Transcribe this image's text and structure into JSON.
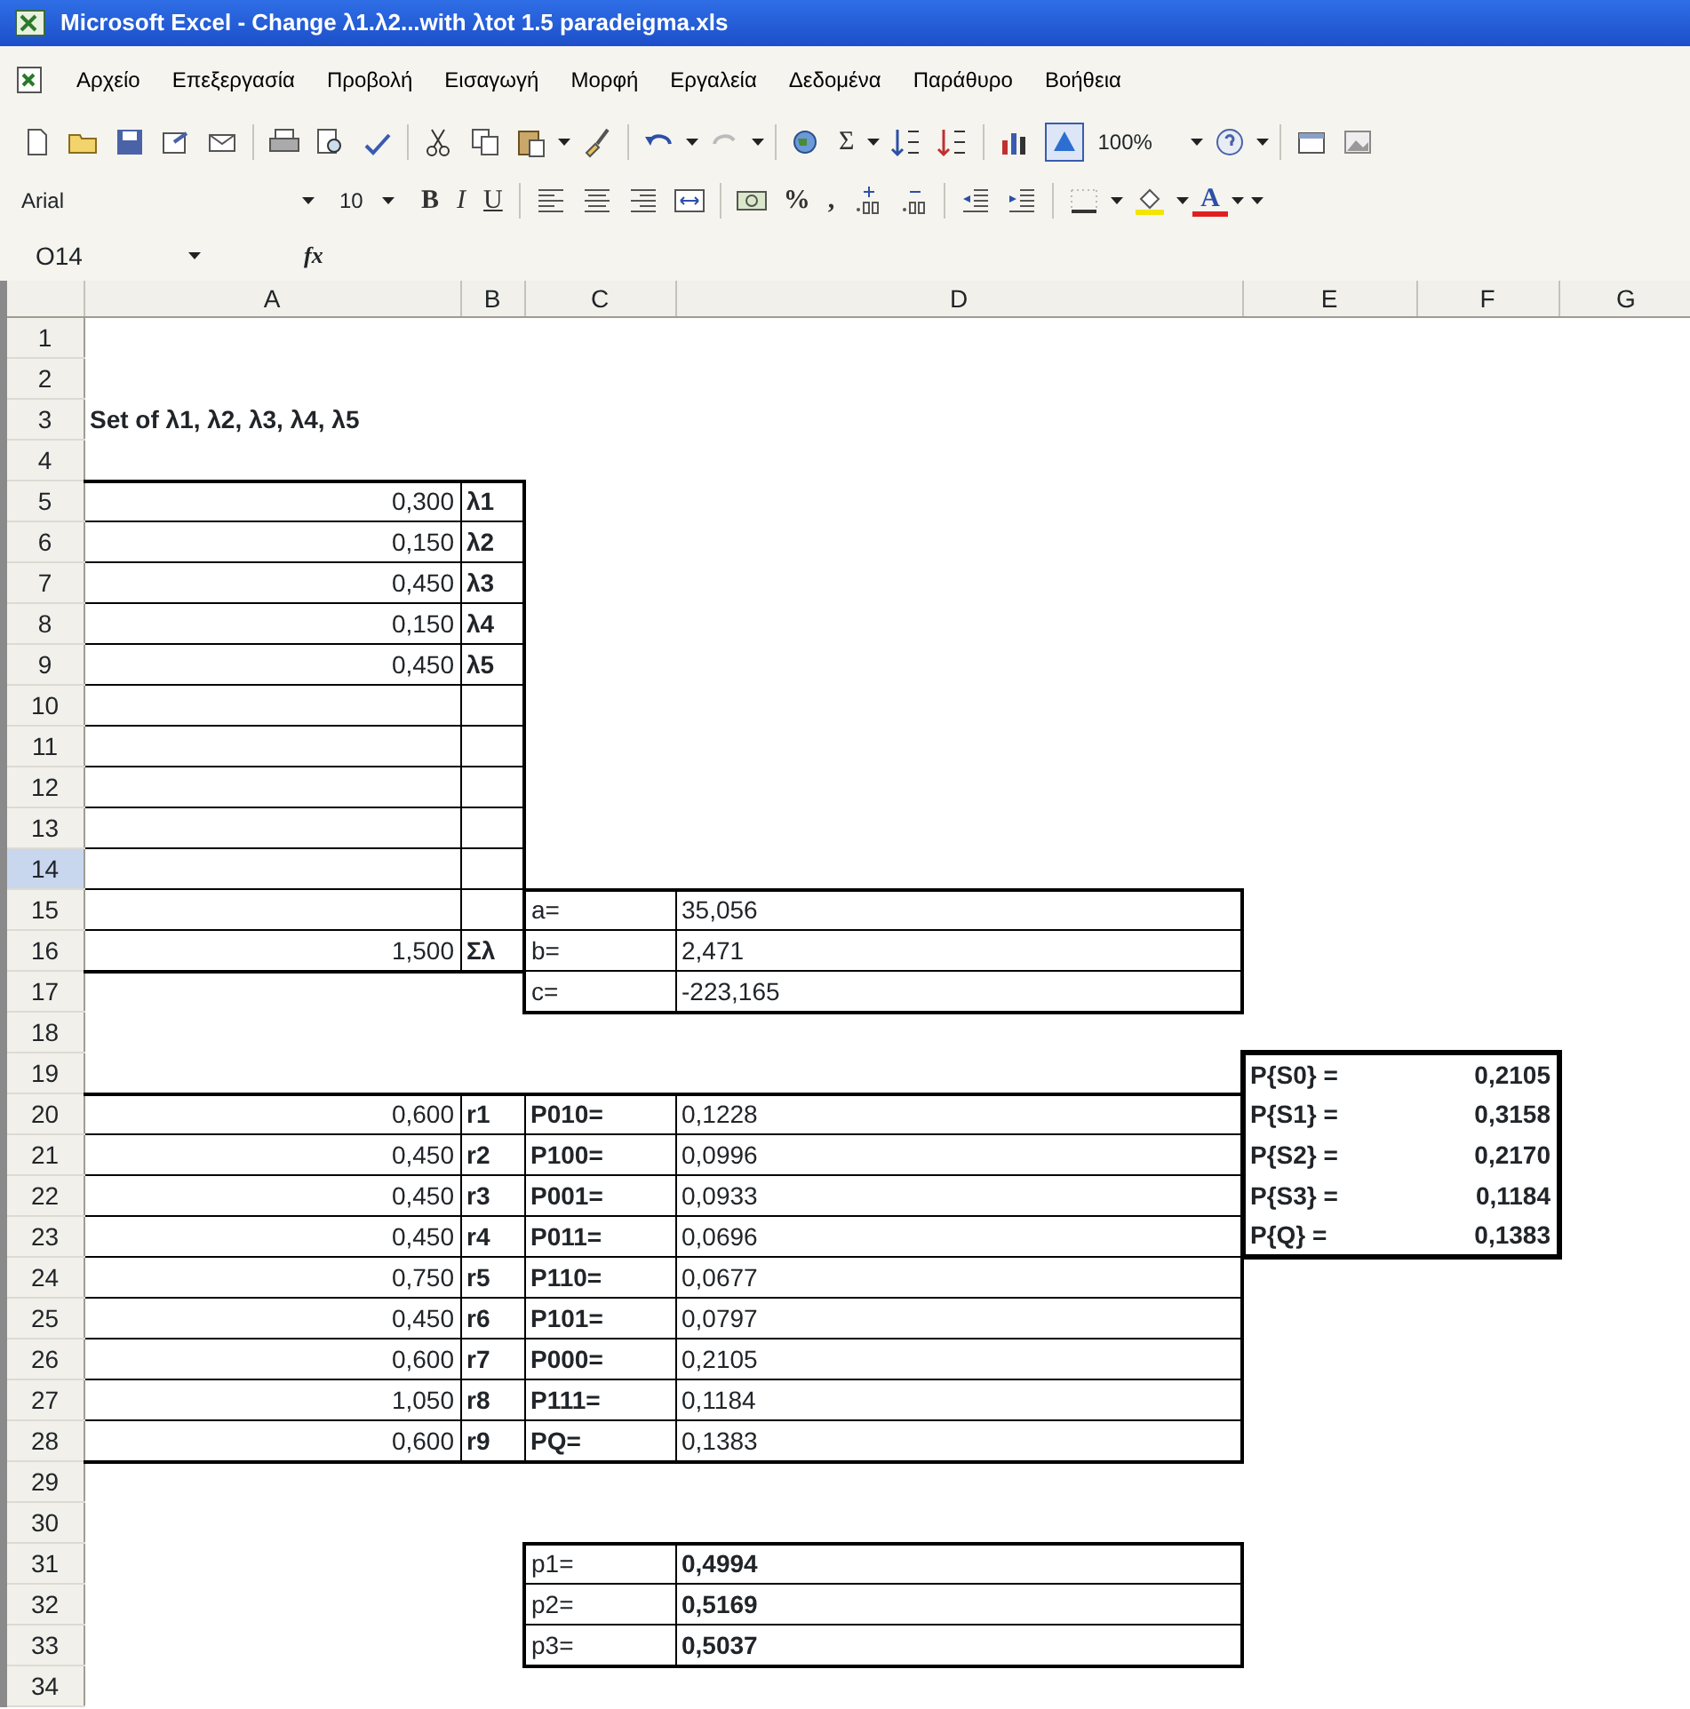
{
  "window": {
    "title": "Microsoft Excel - Change λ1.λ2...with λtot 1.5 paradeigma.xls"
  },
  "menu": [
    "Αρχείο",
    "Επεξεργασία",
    "Προβολή",
    "Εισαγωγή",
    "Μορφή",
    "Εργαλεία",
    "Δεδομένα",
    "Παράθυρο",
    "Βοήθεια"
  ],
  "standard_toolbar": {
    "autosum": "Σ",
    "zoom": "100%"
  },
  "formatting_toolbar": {
    "font": "Arial",
    "size": "10",
    "bold": "B",
    "italic": "I",
    "underline": "U",
    "percent": "%",
    "comma": ",",
    "font_color": "A"
  },
  "formula_bar": {
    "name_box": "O14",
    "fx": "fx"
  },
  "sheet": {
    "columns": [
      "A",
      "B",
      "C",
      "D",
      "E",
      "F",
      "G"
    ],
    "rows": [
      {
        "number": "1",
        "selected": false
      },
      {
        "number": "2",
        "selected": false
      },
      {
        "number": "3",
        "selected": false,
        "col_a": "Set of λ1, λ2, λ3, λ4, λ5"
      },
      {
        "number": "4",
        "selected": false
      },
      {
        "number": "5",
        "selected": false,
        "col_a": "0,300",
        "col_b": "λ1"
      },
      {
        "number": "6",
        "selected": false,
        "col_a": "0,150",
        "col_b": "λ2"
      },
      {
        "number": "7",
        "selected": false,
        "col_a": "0,450",
        "col_b": "λ3"
      },
      {
        "number": "8",
        "selected": false,
        "col_a": "0,150",
        "col_b": "λ4"
      },
      {
        "number": "9",
        "selected": false,
        "col_a": "0,450",
        "col_b": "λ5"
      },
      {
        "number": "10",
        "selected": false
      },
      {
        "number": "11",
        "selected": false
      },
      {
        "number": "12",
        "selected": false
      },
      {
        "number": "13",
        "selected": false
      },
      {
        "number": "14",
        "selected": true
      },
      {
        "number": "15",
        "selected": false,
        "col_c": "a=",
        "col_d": "35,056"
      },
      {
        "number": "16",
        "selected": false,
        "col_a": "1,500",
        "col_b": "Σλ",
        "col_c": "b=",
        "col_d": "2,471"
      },
      {
        "number": "17",
        "selected": false,
        "col_c": "c=",
        "col_d": "-223,165"
      },
      {
        "number": "18",
        "selected": false
      },
      {
        "number": "19",
        "selected": false,
        "col_e": "P{S0} =",
        "col_f": "0,2105"
      },
      {
        "number": "20",
        "selected": false,
        "col_a": "0,600",
        "col_b": "r1",
        "col_c": "P010=",
        "col_d": "0,1228",
        "col_e": "P{S1} =",
        "col_f": "0,3158"
      },
      {
        "number": "21",
        "selected": false,
        "col_a": "0,450",
        "col_b": "r2",
        "col_c": "P100=",
        "col_d": "0,0996",
        "col_e": "P{S2} =",
        "col_f": "0,2170"
      },
      {
        "number": "22",
        "selected": false,
        "col_a": "0,450",
        "col_b": "r3",
        "col_c": "P001=",
        "col_d": "0,0933",
        "col_e": "P{S3} =",
        "col_f": "0,1184"
      },
      {
        "number": "23",
        "selected": false,
        "col_a": "0,450",
        "col_b": "r4",
        "col_c": "P011=",
        "col_d": "0,0696",
        "col_e": "P{Q} =",
        "col_f": "0,1383"
      },
      {
        "number": "24",
        "selected": false,
        "col_a": "0,750",
        "col_b": "r5",
        "col_c": "P110=",
        "col_d": "0,0677"
      },
      {
        "number": "25",
        "selected": false,
        "col_a": "0,450",
        "col_b": "r6",
        "col_c": "P101=",
        "col_d": "0,0797"
      },
      {
        "number": "26",
        "selected": false,
        "col_a": "0,600",
        "col_b": "r7",
        "col_c": "P000=",
        "col_d": "0,2105"
      },
      {
        "number": "27",
        "selected": false,
        "col_a": "1,050",
        "col_b": "r8",
        "col_c": "P111=",
        "col_d": "0,1184"
      },
      {
        "number": "28",
        "selected": false,
        "col_a": "0,600",
        "col_b": "r9",
        "col_c": "PQ=",
        "col_d": "0,1383"
      },
      {
        "number": "29",
        "selected": false
      },
      {
        "number": "30",
        "selected": false
      },
      {
        "number": "31",
        "selected": false,
        "col_c": "p1=",
        "col_d": "0,4994"
      },
      {
        "number": "32",
        "selected": false,
        "col_c": "p2=",
        "col_d": "0,5169"
      },
      {
        "number": "33",
        "selected": false,
        "col_c": "p3=",
        "col_d": "0,5037"
      },
      {
        "number": "34",
        "selected": false
      }
    ]
  }
}
